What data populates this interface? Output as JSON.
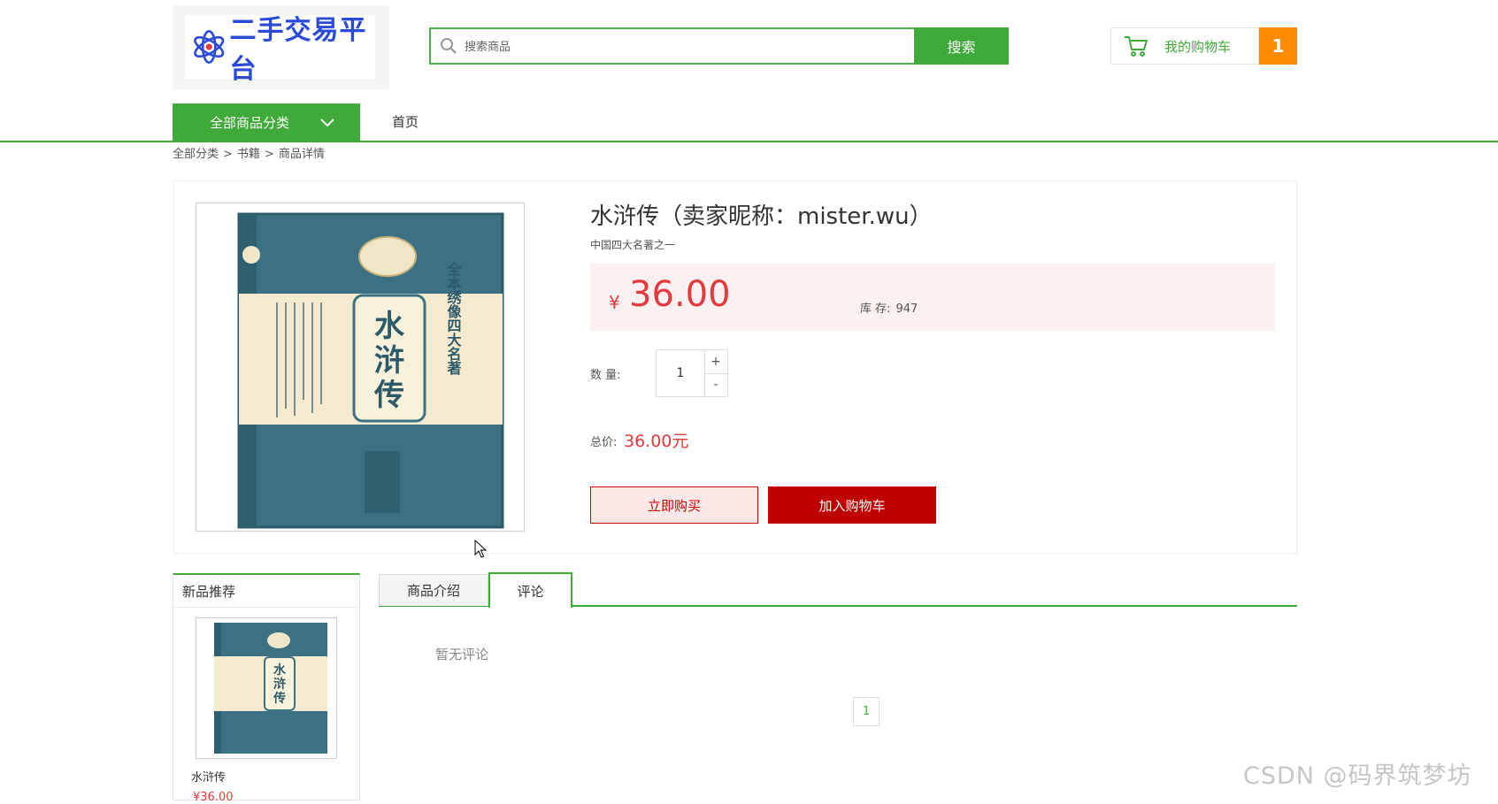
{
  "header": {
    "logo_text": "二手交易平台",
    "search": {
      "placeholder": "搜索商品",
      "button_label": "搜索"
    },
    "cart": {
      "label": "我的购物车",
      "count": "1"
    }
  },
  "nav": {
    "category_label": "全部商品分类",
    "home_label": "首页"
  },
  "breadcrumb": [
    "全部分类",
    ">",
    "书籍",
    ">",
    "商品详情"
  ],
  "product": {
    "title": "水浒传（卖家昵称：mister.wu）",
    "subtitle": "中国四大名著之一",
    "currency_symbol": "¥",
    "price": "36.00",
    "stock_label": "库 存:",
    "stock_value": "947",
    "quantity_label": "数 量:",
    "quantity": "1",
    "plus": "+",
    "minus": "-",
    "total_label": "总价:",
    "total_value": "36.00元",
    "buy_now_label": "立即购买",
    "add_to_cart_label": "加入购物车",
    "cover": {
      "title": "水浒传",
      "series": "全本绣像四大名著"
    }
  },
  "sidebar": {
    "title": "新品推荐",
    "items": [
      {
        "name": "水浒传",
        "price": "¥36.00"
      }
    ]
  },
  "tabs": [
    {
      "label": "商品介绍"
    },
    {
      "label": "评论"
    }
  ],
  "reviews": {
    "empty_text": "暂无评论",
    "page": "1"
  },
  "watermark": "CSDN @码界筑梦坊",
  "colors": {
    "brand_green": "#3fa93a",
    "price_red": "#e4393c",
    "cart_orange": "#ff8c00",
    "buy_red": "#c00000",
    "cover_teal": "#3b7183"
  }
}
